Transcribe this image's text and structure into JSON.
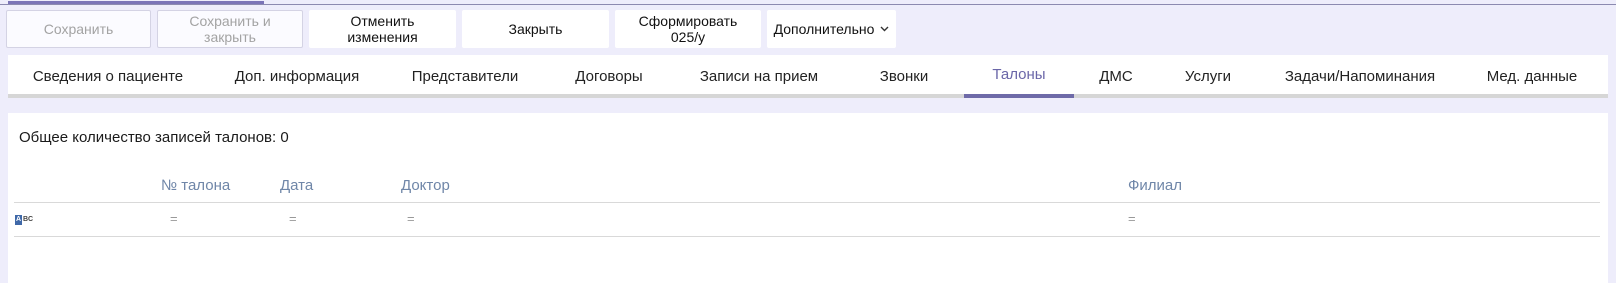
{
  "toolbar": {
    "save_label": "Сохранить",
    "save_close_label": "Сохранить и закрыть",
    "cancel_label": "Отменить изменения",
    "close_label": "Закрыть",
    "form_label": "Сформировать 025/у",
    "more_label": "Дополнительно"
  },
  "tabs": [
    {
      "label": "Сведения о пациенте"
    },
    {
      "label": "Доп. информация"
    },
    {
      "label": "Представители"
    },
    {
      "label": "Договоры"
    },
    {
      "label": "Записи на прием"
    },
    {
      "label": "Звонки"
    },
    {
      "label": "Талоны"
    },
    {
      "label": "ДМС"
    },
    {
      "label": "Услуги"
    },
    {
      "label": "Задачи/Напоминания"
    },
    {
      "label": "Мед. данные"
    }
  ],
  "active_tab": "Талоны",
  "main": {
    "count_text": "Общее количество записей талонов: 0",
    "columns": [
      "№ талона",
      "Дата",
      "Доктор",
      "Филиал"
    ],
    "filter_operator": "="
  },
  "colors": {
    "accent": "#6e6aa8",
    "header_text": "#6f86a8",
    "background": "#eeedfb"
  }
}
